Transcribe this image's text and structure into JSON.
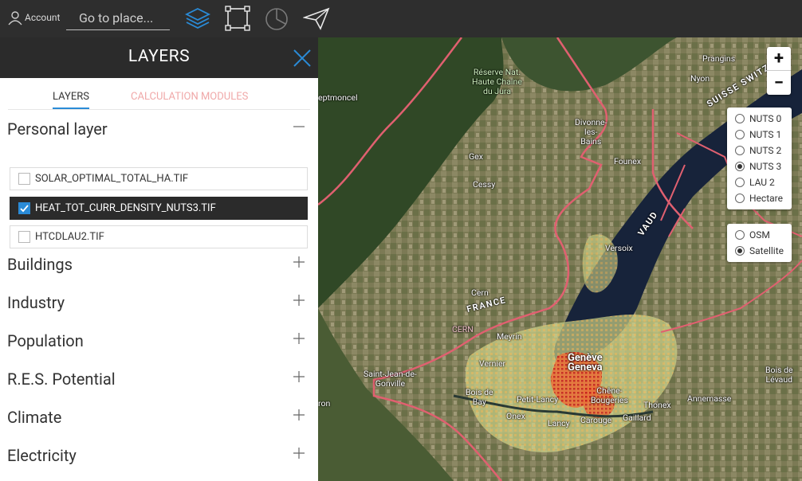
{
  "header": {
    "account_label": "Account",
    "search_placeholder": "Go to place...",
    "tools": [
      {
        "name": "layers-tool",
        "icon": "layers-icon"
      },
      {
        "name": "selection-tool",
        "icon": "square-selection-icon"
      },
      {
        "name": "chart-tool",
        "icon": "pie-chart-icon"
      },
      {
        "name": "send-tool",
        "icon": "paper-plane-icon"
      }
    ]
  },
  "sidebar": {
    "title": "LAYERS",
    "tabs": [
      "LAYERS",
      "CALCULATION MODULES"
    ],
    "personal_layer": {
      "label": "Personal layer",
      "items": [
        {
          "label": "SOLAR_OPTIMAL_TOTAL_HA.TIF",
          "checked": false
        },
        {
          "label": "HEAT_TOT_CURR_DENSITY_NUTS3.TIF",
          "checked": true
        },
        {
          "label": "HTCDLAU2.TIF",
          "checked": false
        }
      ]
    },
    "sections": [
      "Buildings",
      "Industry",
      "Population",
      "R.E.S. Potential",
      "Climate",
      "Electricity"
    ]
  },
  "map": {
    "zoom_in": "+",
    "zoom_out": "−",
    "nuts_options": [
      {
        "label": "NUTS 0",
        "selected": false
      },
      {
        "label": "NUTS 1",
        "selected": false
      },
      {
        "label": "NUTS 2",
        "selected": false
      },
      {
        "label": "NUTS 3",
        "selected": true
      },
      {
        "label": "LAU 2",
        "selected": false
      },
      {
        "label": "Hectare",
        "selected": false
      }
    ],
    "basemap_options": [
      {
        "label": "OSM",
        "selected": false
      },
      {
        "label": "Satellite",
        "selected": true
      }
    ],
    "places": {
      "reserve": "Réserve Nat.\nHaute Chaîne\ndu Jura",
      "montcel": "eptmoncel",
      "prangins": "Prangins",
      "nyon": "Nyon",
      "divonne": "Divonne-\nles-\nBains",
      "gex": "Gex",
      "founex": "Founex",
      "cessy": "Cessy",
      "versoix": "Versoix",
      "cern_town": "Cern",
      "cern": "CERN",
      "meyrin": "Meyrin",
      "vernier": "Vernier",
      "geneve": "Genève\nGeneva",
      "saint_jean": "Saint-Jean-de-\nGonville",
      "bois_bay": "Bois de\nBay",
      "petit_lancy": "Petit-Lancy",
      "chene": "Chêne-\nBougeries",
      "onex": "Onex",
      "lancy": "Lancy",
      "carouge": "Carouge",
      "gaillard": "Gaillard",
      "thonex": "Thonex",
      "annemasse": "Annemasse",
      "bois_levaud": "Bois de\nLévaud",
      "ron": "ron",
      "france": "FRANCE",
      "vaud": "VAUD",
      "suisse": "SUISSE SWITZ"
    }
  },
  "colors": {
    "topbar": "#2e2e2e",
    "accent_blue": "#2a8bd7",
    "inactive_tab": "#f0a8a8",
    "border_line": "#e06070",
    "lake": "#17233a"
  }
}
